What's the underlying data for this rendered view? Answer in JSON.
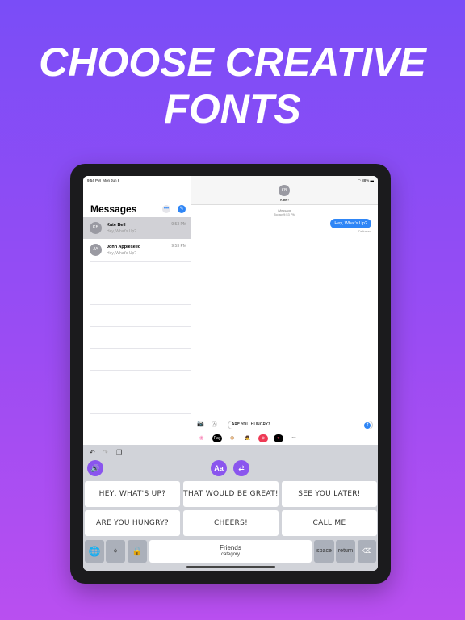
{
  "headline": {
    "line1": "CHOOSE CREATIVE",
    "line2": "FONTS"
  },
  "status": {
    "time": "9:54 PM",
    "date": "Mon Jun 8",
    "battery": "88%"
  },
  "sidebar": {
    "title": "Messages",
    "more_icon": "ellipsis-icon",
    "compose_icon": "compose-icon",
    "conversations": [
      {
        "initials": "KB",
        "name": "Kate Bell",
        "preview": "Hey, What's Up?",
        "time": "9:53 PM",
        "selected": true
      },
      {
        "initials": "JA",
        "name": "John Appleseed",
        "preview": "Hey, What's Up?",
        "time": "9:53 PM",
        "selected": false
      }
    ]
  },
  "chat": {
    "initials": "KB",
    "contact": "Kate ›",
    "service": "iMessage",
    "timestamp": "Today 9:53 PM",
    "message": "Hey, What's Up?",
    "receipt": "Delivered",
    "input_value": "ARE YOU HUNGRY?"
  },
  "app_strip": {
    "applepay": "Pay",
    "more": "•••"
  },
  "keyboard": {
    "phrases": [
      "HEY, WHAT'S UP?",
      "THAT WOULD BE GREAT!",
      "SEE YOU LATER!",
      "ARE YOU HUNGRY?",
      "CHEERS!",
      "CALL ME"
    ],
    "category": "Friends",
    "category_sub": "category",
    "space": "space",
    "return": "return",
    "accent": "#8a55ee"
  }
}
